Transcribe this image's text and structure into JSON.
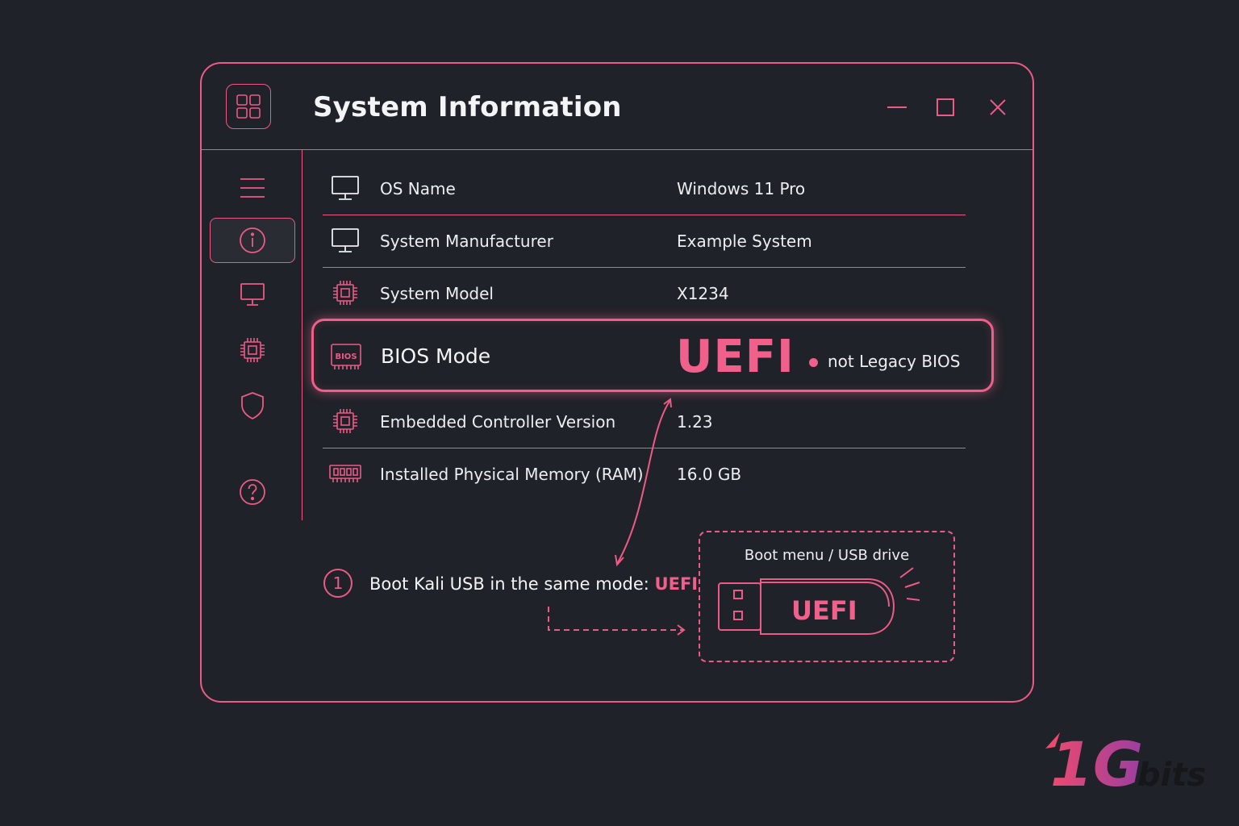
{
  "window": {
    "title": "System Information",
    "controls": {
      "minimize": "minimize",
      "maximize": "maximize",
      "close": "close"
    }
  },
  "sidebar": {
    "items": [
      {
        "icon": "menu-icon",
        "active": false
      },
      {
        "icon": "info-icon",
        "active": true
      },
      {
        "icon": "monitor-icon",
        "active": false
      },
      {
        "icon": "chip-icon",
        "active": false
      },
      {
        "icon": "shield-icon",
        "active": false
      },
      {
        "icon": "help-icon",
        "active": false
      }
    ]
  },
  "rows": [
    {
      "icon": "monitor-icon",
      "label": "OS Name",
      "value": "Windows 11 Pro"
    },
    {
      "icon": "monitor-icon",
      "label": "System Manufacturer",
      "value": "Example System"
    },
    {
      "icon": "chip-icon",
      "label": "System Model",
      "value": "X1234"
    }
  ],
  "bios": {
    "icon_text": "BIOS",
    "label": "BIOS Mode",
    "value": "UEFI",
    "note": "not Legacy BIOS"
  },
  "rows_after": [
    {
      "icon": "chip-icon",
      "label": "Embedded Controller Version",
      "value": "1.23"
    },
    {
      "icon": "memory-icon",
      "label": "Installed Physical Memory (RAM)",
      "value": "16.0 GB"
    }
  ],
  "step": {
    "number": "1",
    "text": "Boot Kali USB in the same mode: ",
    "highlight": "UEFI"
  },
  "usb": {
    "caption": "Boot menu / USB drive",
    "label": "UEFI"
  },
  "logo": {
    "main": "1G",
    "suffix": "bits"
  },
  "colors": {
    "accent": "#ec5a85",
    "background": "#1f2228",
    "text": "#eceef1"
  }
}
